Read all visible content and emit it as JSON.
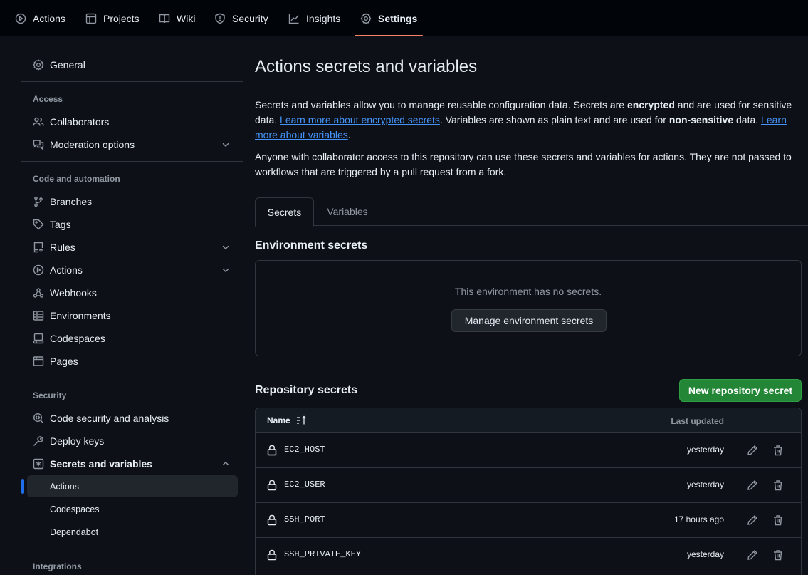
{
  "repo_nav": {
    "tabs": [
      {
        "label": "Actions",
        "icon": "play-circle-icon"
      },
      {
        "label": "Projects",
        "icon": "table-icon"
      },
      {
        "label": "Wiki",
        "icon": "book-icon"
      },
      {
        "label": "Security",
        "icon": "shield-icon"
      },
      {
        "label": "Insights",
        "icon": "graph-icon"
      },
      {
        "label": "Settings",
        "icon": "gear-icon",
        "active": true
      }
    ]
  },
  "sidebar": {
    "general": "General",
    "access_heading": "Access",
    "collaborators": "Collaborators",
    "moderation": "Moderation options",
    "code_heading": "Code and automation",
    "branches": "Branches",
    "tags": "Tags",
    "rules": "Rules",
    "actions": "Actions",
    "webhooks": "Webhooks",
    "environments": "Environments",
    "codespaces": "Codespaces",
    "pages": "Pages",
    "security_heading": "Security",
    "code_security": "Code security and analysis",
    "deploy_keys": "Deploy keys",
    "secrets_vars": "Secrets and variables",
    "sub_actions": "Actions",
    "sub_codespaces": "Codespaces",
    "sub_dependabot": "Dependabot",
    "integrations_heading": "Integrations"
  },
  "main": {
    "title": "Actions secrets and variables",
    "intro": {
      "p1_a": "Secrets and variables allow you to manage reusable configuration data. Secrets are ",
      "p1_b": "encrypted",
      "p1_c": " and are used for sensitive data. ",
      "p1_link1": "Learn more about encrypted secrets",
      "p1_d": ". Variables are shown as plain text and are used for ",
      "p1_e": "non-sensitive",
      "p1_f": " data. ",
      "p1_link2": "Learn more about variables",
      "p1_g": ".",
      "p2": "Anyone with collaborator access to this repository can use these secrets and variables for actions. They are not passed to workflows that are triggered by a pull request from a fork."
    },
    "tabs": {
      "secrets": "Secrets",
      "variables": "Variables"
    },
    "env_title": "Environment secrets",
    "env_empty": "This environment has no secrets.",
    "env_button": "Manage environment secrets",
    "repo_title": "Repository secrets",
    "new_button": "New repository secret",
    "table": {
      "col_name": "Name",
      "col_updated": "Last updated",
      "rows": [
        {
          "name": "EC2_HOST",
          "updated": "yesterday"
        },
        {
          "name": "EC2_USER",
          "updated": "yesterday"
        },
        {
          "name": "SSH_PORT",
          "updated": "17 hours ago"
        },
        {
          "name": "SSH_PRIVATE_KEY",
          "updated": "yesterday"
        }
      ]
    }
  },
  "colors": {
    "background": "#0d1117",
    "accent_underline": "#f78166",
    "link": "#4493f8",
    "primary_button": "#238636",
    "active_marker": "#1f6feb"
  }
}
